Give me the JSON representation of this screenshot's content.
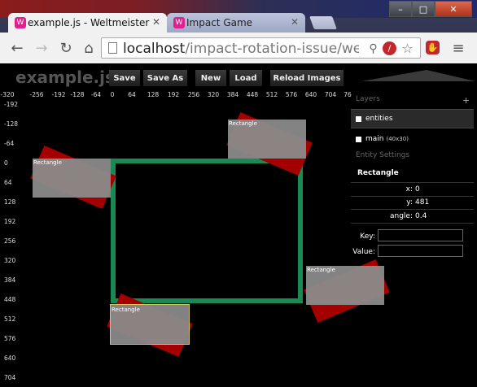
{
  "browser": {
    "tabs": [
      {
        "title": "example.js - Weltmeister",
        "favicon": "W"
      },
      {
        "title": "Impact Game",
        "favicon": "W"
      }
    ],
    "url_host": "localhost",
    "url_path": "/impact-rotation-issue/weltmeist"
  },
  "editor": {
    "title": "example.js",
    "buttons": [
      "Save",
      "Save As",
      "New",
      "Load",
      "Reload Images"
    ]
  },
  "canvas": {
    "x_ticks": [
      "-320",
      "-256",
      "-192",
      "-128",
      "-64",
      "0",
      "64",
      "128",
      "192",
      "256",
      "320",
      "384",
      "448",
      "512",
      "576",
      "640",
      "704",
      "76"
    ],
    "y_ticks": [
      "-192",
      "-128",
      "-64",
      "0",
      "64",
      "128",
      "192",
      "256",
      "320",
      "384",
      "448",
      "512",
      "576",
      "640",
      "704"
    ],
    "entity_label": "Rectangle"
  },
  "sidebar": {
    "layers_heading": "Layers",
    "add_symbol": "+",
    "layers": [
      {
        "name": "entities",
        "size": ""
      },
      {
        "name": "main",
        "size": "(40x30)"
      }
    ],
    "settings_heading": "Entity Settings",
    "entity_name": "Rectangle",
    "properties": [
      {
        "key": "x",
        "value": "0"
      },
      {
        "key": "y",
        "value": "481"
      },
      {
        "key": "angle",
        "value": "0.4"
      }
    ],
    "key_label": "Key:",
    "value_label": "Value:"
  }
}
